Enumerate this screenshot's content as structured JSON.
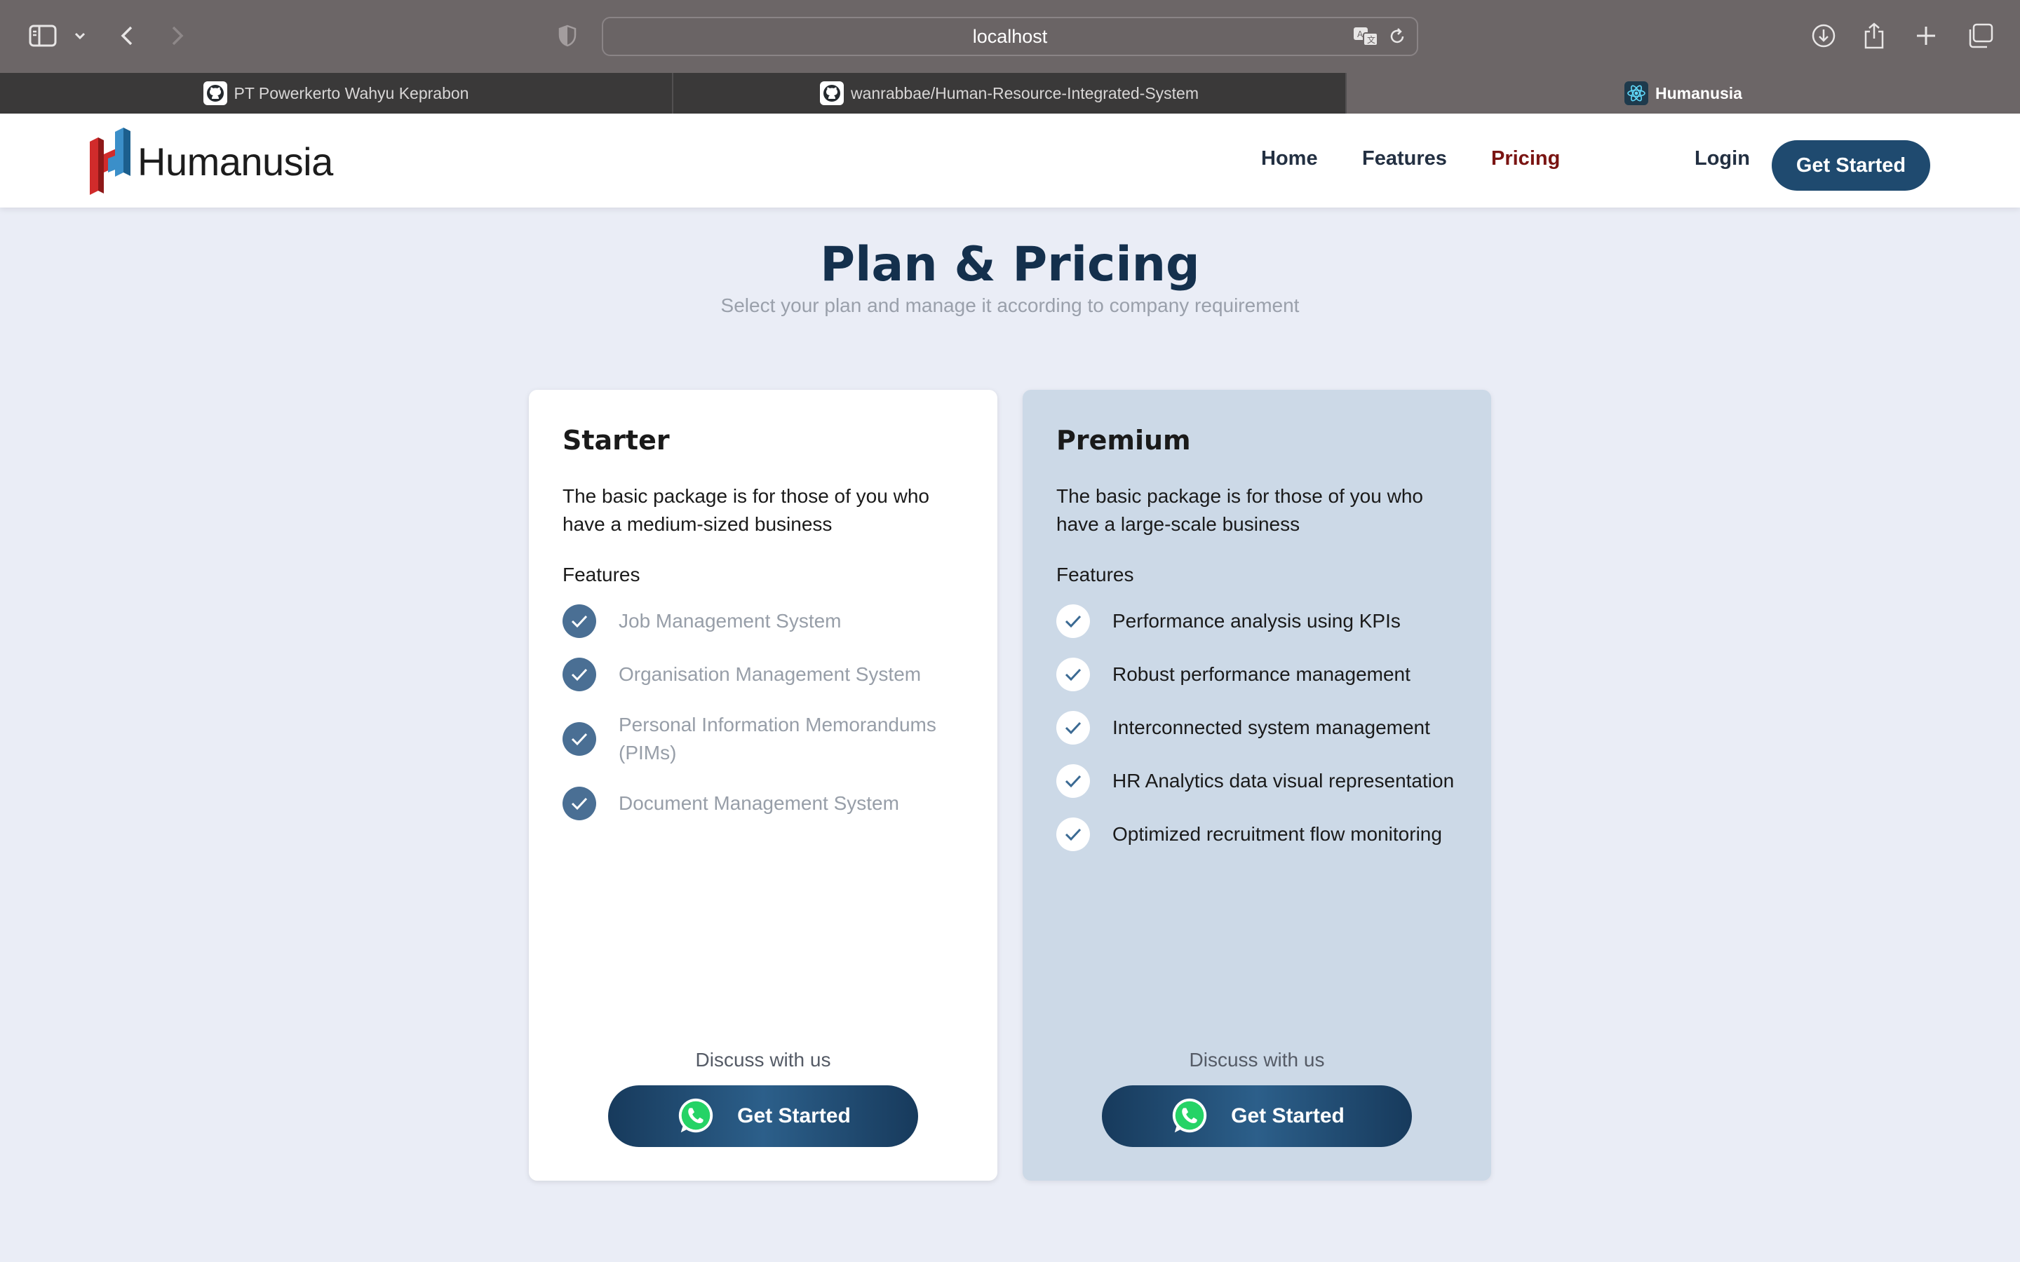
{
  "browser": {
    "url": "localhost",
    "tabs": [
      {
        "title": "PT Powerkerto Wahyu Keprabon",
        "icon": "github-icon",
        "active": false
      },
      {
        "title": "wanrabbae/Human-Resource-Integrated-System",
        "icon": "github-icon",
        "active": false
      },
      {
        "title": "Humanusia",
        "icon": "react-icon",
        "active": true
      }
    ]
  },
  "header": {
    "logo_text": "Humanusia",
    "nav": [
      {
        "label": "Home"
      },
      {
        "label": "Features"
      },
      {
        "label": "Pricing",
        "active": true
      }
    ],
    "login_label": "Login",
    "cta_label": "Get Started"
  },
  "main": {
    "title": "Plan & Pricing",
    "subtitle": "Select your plan and manage it according to company requirement"
  },
  "plans": [
    {
      "name": "Starter",
      "description": "The basic package is for those of you who have a medium-sized business",
      "features_label": "Features",
      "features": [
        "Job Management System",
        "Organisation Management System",
        "Personal Information Memorandums (PIMs)",
        "Document Management System"
      ],
      "discuss_label": "Discuss with us",
      "cta_label": "Get Started"
    },
    {
      "name": "Premium",
      "description": "The basic package is for those of you who have a large-scale business",
      "features_label": "Features",
      "features": [
        "Performance analysis using KPIs",
        "Robust performance management",
        "Interconnected system management",
        "HR Analytics data visual representation",
        "Optimized recruitment flow monitoring"
      ],
      "discuss_label": "Discuss with us",
      "cta_label": "Get Started"
    }
  ],
  "colors": {
    "brand_dark": "#1f4a6f",
    "title": "#14304d",
    "nav_active": "#7a1412",
    "premium_bg": "#ccd9e7",
    "whatsapp": "#25d366"
  }
}
